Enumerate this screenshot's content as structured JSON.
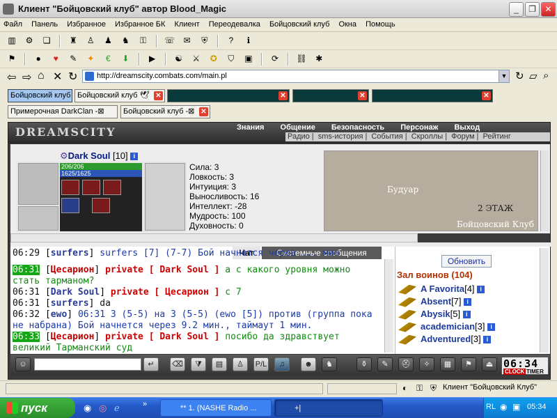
{
  "window": {
    "title": "Клиент \"Бойцовский клуб\" автор Blood_Magic",
    "min": "_",
    "max": "❐",
    "close": "✕"
  },
  "menu": [
    "Файл",
    "Панель",
    "Избранное",
    "Избранное БК",
    "Клиент",
    "Переодевалка",
    "Бойцовский клуб",
    "Окна",
    "Помощь"
  ],
  "address": {
    "url": "http://dreamscity.combats.com/main.pl"
  },
  "tabs": {
    "row1": [
      {
        "label": "Бойцовский клуб"
      },
      {
        "label": "Бойцовский клуб 🕊"
      },
      {
        "label": ""
      },
      {
        "label": ""
      },
      {
        "label": ""
      }
    ],
    "row2": [
      {
        "label": "Примерочная DarkClan -⊠"
      },
      {
        "label": "Бойцовский клуб -⊠"
      }
    ]
  },
  "game": {
    "logo": "DREAMSCITY",
    "topnav": [
      "Знания",
      "Общение",
      "Безопасность",
      "Персонаж",
      "Выход"
    ],
    "subnav": [
      "Радио",
      "sms-история",
      "События",
      "Скроллы",
      "Форум",
      "Рейтинг"
    ],
    "character": {
      "name": "Dark Soul",
      "level": "[10]",
      "hp": "206/206",
      "mana": "1625/1625"
    },
    "stats": [
      "Сила: 3",
      "Ловкость: 3",
      "Интуиция: 3",
      "Выносливость: 16",
      "Интеллект: -28",
      "Мудрость: 100",
      "Духовность: 0"
    ],
    "map": {
      "room": "Будуар",
      "floor": "2 ЭТАЖ",
      "club": "Бойцовский Клуб"
    },
    "chat_tabs": {
      "chat": "Чат",
      "system": "Системные сообщения"
    },
    "chat": [
      {
        "time": "06:29",
        "nick": "surfers",
        "text": "surfers [7] (7-7) Бой начнется через ... мин"
      },
      {
        "time": "06:31",
        "nick": "Цесарион",
        "private": "private [ Dark Soul ]",
        "text": "а с какого уровня можно стать тарманом?"
      },
      {
        "time": "06:31",
        "nick": "Dark Soul",
        "private": "private [ Цесарион ]",
        "text": "с 7"
      },
      {
        "time": "06:31",
        "nick": "surfers",
        "text": "da"
      },
      {
        "time": "06:32",
        "nick": "ewo",
        "text": "06:31 3 (5-5) на 3 (5-5) (ewo [5]) против (группа пока не набрана) Бой начнется через 9.2 мин., таймаут 1 мин."
      },
      {
        "time": "06:33",
        "nick": "Цесарион",
        "private": "private [ Dark Soul ]",
        "text": "посибо да здравствует великий Тарманский суд"
      }
    ],
    "refresh": "Обновить",
    "hall": "Зал воинов (104)",
    "players": [
      {
        "name": "A Favorita",
        "lvl": "[4]"
      },
      {
        "name": "Absent",
        "lvl": "[7]"
      },
      {
        "name": "Abysik",
        "lvl": "[5]"
      },
      {
        "name": "academician",
        "lvl": "[3]"
      },
      {
        "name": "Adventured",
        "lvl": "[3]"
      }
    ],
    "clock": {
      "time": "06:34",
      "label1": "CLOCK",
      "label2": "TIMER"
    }
  },
  "status": {
    "text": "Клиент \"Бойцовский Клуб\""
  },
  "taskbar": {
    "start": "пуск",
    "tasks": [
      "** 1. (NASHE Radio ...",
      "+|"
    ],
    "lang": "RL",
    "time": "05:34"
  }
}
